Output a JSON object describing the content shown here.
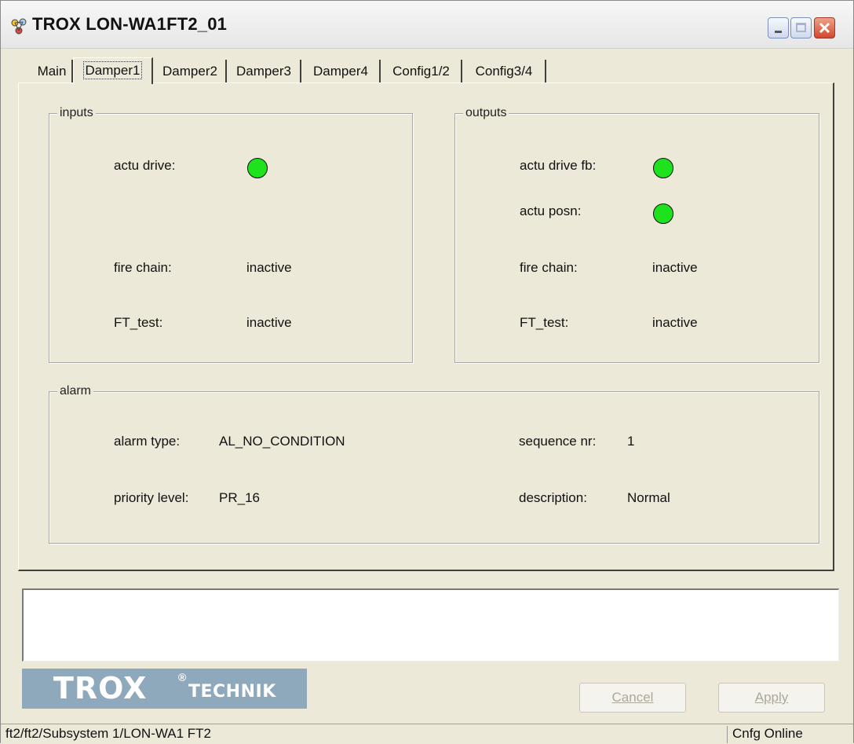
{
  "window": {
    "title": "TROX LON-WA1FT2_01"
  },
  "tabs": [
    {
      "label": "Main"
    },
    {
      "label": "Damper1"
    },
    {
      "label": "Damper2"
    },
    {
      "label": "Damper3"
    },
    {
      "label": "Damper4"
    },
    {
      "label": "Config1/2"
    },
    {
      "label": "Config3/4"
    }
  ],
  "active_tab": "Damper1",
  "inputs": {
    "legend": "inputs",
    "actu_drive_label": "actu drive:",
    "actu_drive_state": "on",
    "fire_chain_label": "fire chain:",
    "fire_chain_value": "inactive",
    "ft_test_label": "FT_test:",
    "ft_test_value": "inactive"
  },
  "outputs": {
    "legend": "outputs",
    "actu_drive_fb_label": "actu drive fb:",
    "actu_drive_fb_state": "on",
    "actu_posn_label": "actu posn:",
    "actu_posn_state": "on",
    "fire_chain_label": "fire chain:",
    "fire_chain_value": "inactive",
    "ft_test_label": "FT_test:",
    "ft_test_value": "inactive"
  },
  "alarm": {
    "legend": "alarm",
    "alarm_type_label": "alarm type:",
    "alarm_type_value": "AL_NO_CONDITION",
    "priority_level_label": "priority level:",
    "priority_level_value": "PR_16",
    "sequence_nr_label": "sequence nr:",
    "sequence_nr_value": "1",
    "description_label": "description:",
    "description_value": "Normal"
  },
  "logo": {
    "main": "TROX",
    "registered": "®",
    "sub": "TECHNIK"
  },
  "buttons": {
    "cancel_label": "Cancel",
    "apply_label": "Apply",
    "cancel_enabled": false,
    "apply_enabled": false
  },
  "statusbar": {
    "path": "ft2/ft2/Subsystem 1/LON-WA1 FT2",
    "mode": "Cnfg Online"
  },
  "colors": {
    "led_on": "#1fe21f",
    "face": "#ece9d8",
    "logo_bg": "#8fa9bc"
  },
  "icons": {
    "app": "network-nodes-icon",
    "minimize": "minimize-icon",
    "maximize": "maximize-icon",
    "close": "close-icon"
  }
}
